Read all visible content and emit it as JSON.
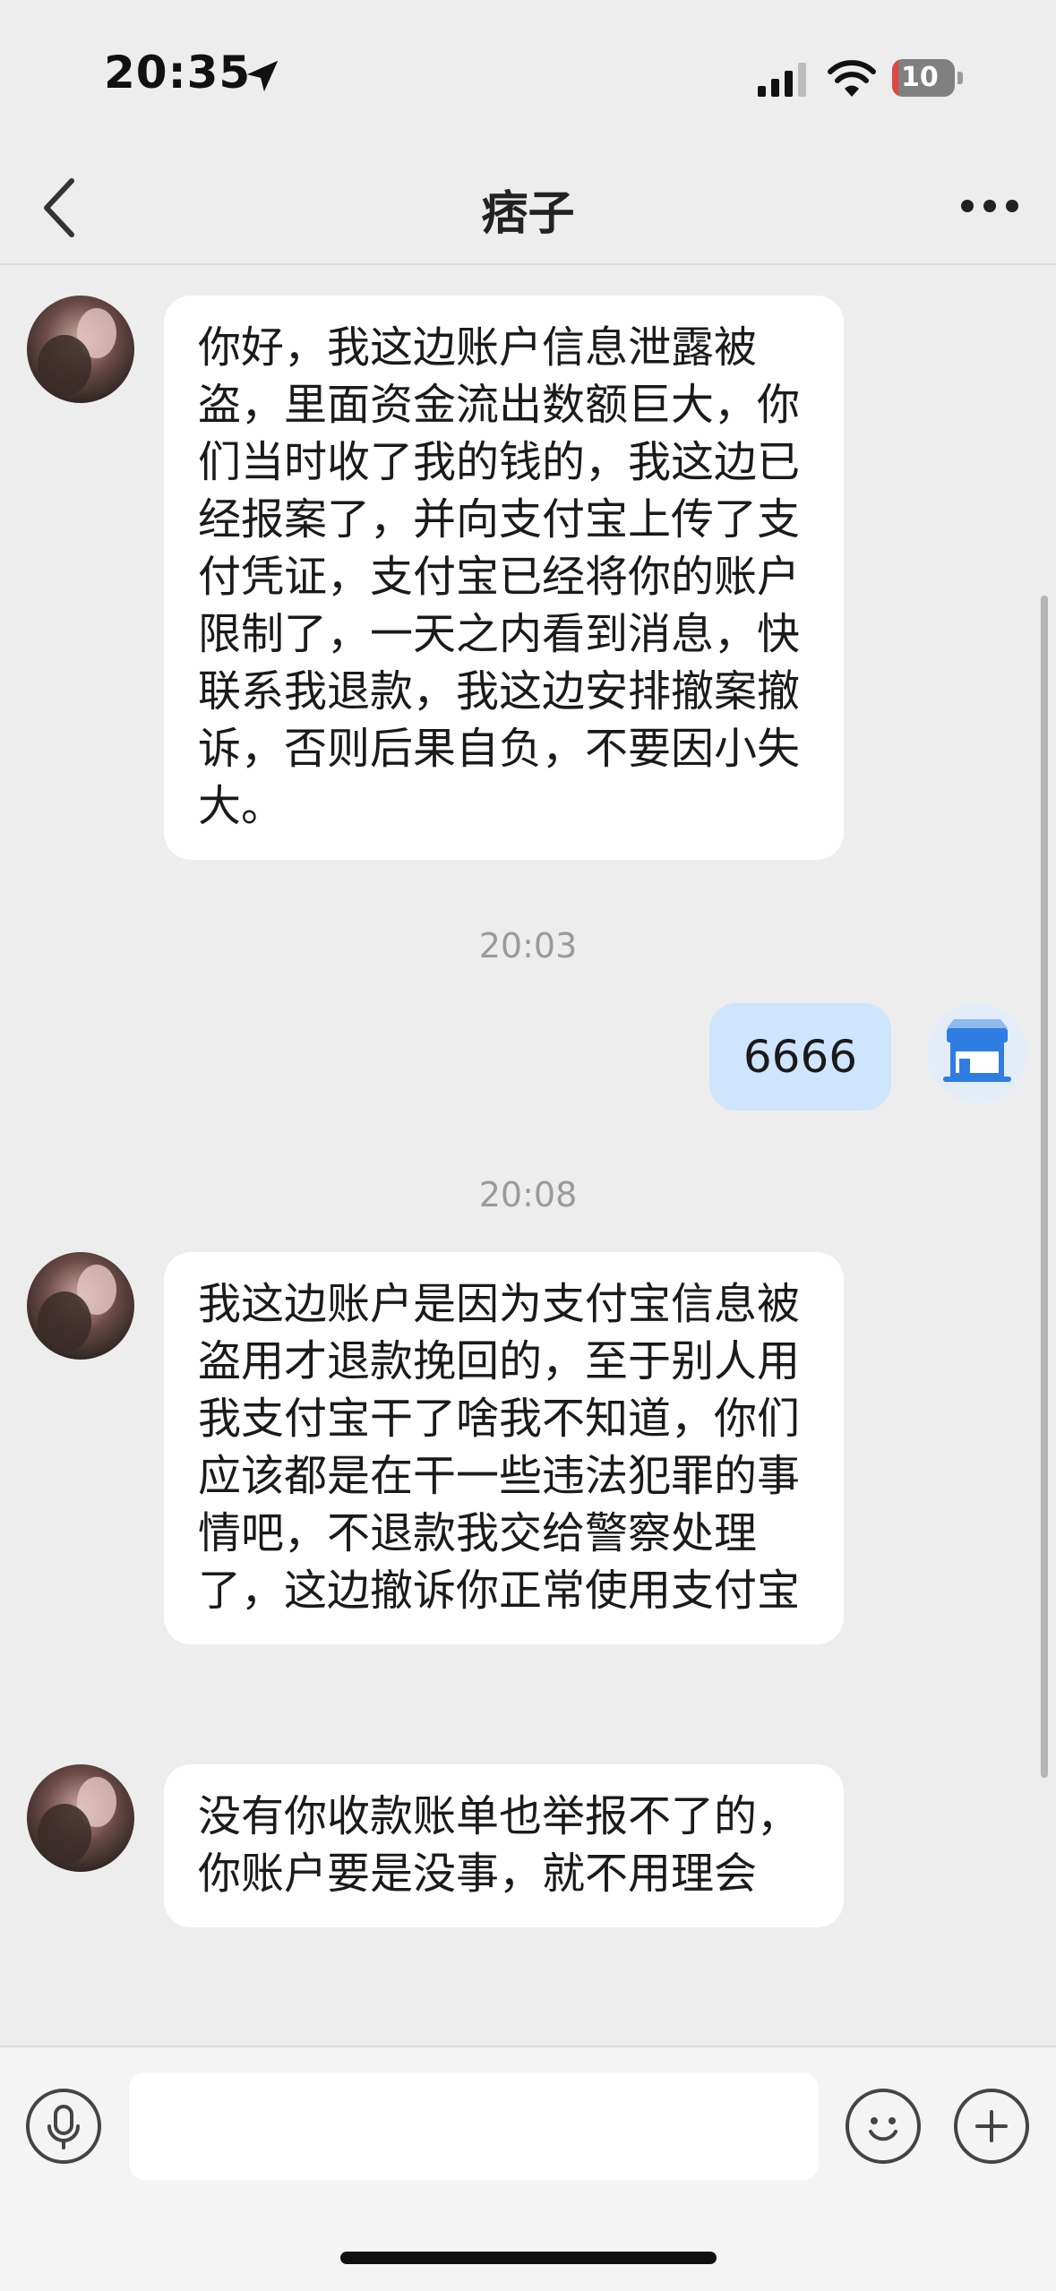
{
  "status_bar": {
    "time": "20:35",
    "battery_level": "10",
    "battery_fraction": 0.1
  },
  "nav": {
    "title": "痞子",
    "back_icon": "chevron-left-icon",
    "more_icon": "more-horizontal-icon"
  },
  "messages": [
    {
      "direction": "incoming",
      "text": "你好，我这边账户信息泄露被盗，里面资金流出数额巨大，你们当时收了我的钱的，我这边已经报案了，并向支付宝上传了支付凭证，支付宝已经将你的账户限制了，一天之内看到消息，快联系我退款，我这边安排撤案撤诉，否则后果自负，不要因小失大。"
    },
    {
      "direction": "outgoing",
      "text": "6666",
      "timestamp": "20:03"
    },
    {
      "direction": "incoming",
      "text": "我这边账户是因为支付宝信息被盗用才退款挽回的，至于别人用我支付宝干了啥我不知道，你们应该都是在干一些违法犯罪的事情吧，不退款我交给警察处理了，这边撤诉你正常使用支付宝",
      "timestamp": "20:08"
    },
    {
      "direction": "incoming",
      "text": "没有你收款账单也举报不了的，你账户要是没事，就不用理会"
    }
  ],
  "input_bar": {
    "voice_icon": "microphone-icon",
    "emoji_icon": "smiley-icon",
    "plus_icon": "plus-icon",
    "input_placeholder": ""
  },
  "colors": {
    "background": "#ededed",
    "incoming_bubble": "#ffffff",
    "outgoing_bubble": "#cfe4fd",
    "battery_low": "#e2473e",
    "store_icon_blue": "#2f7de1"
  }
}
